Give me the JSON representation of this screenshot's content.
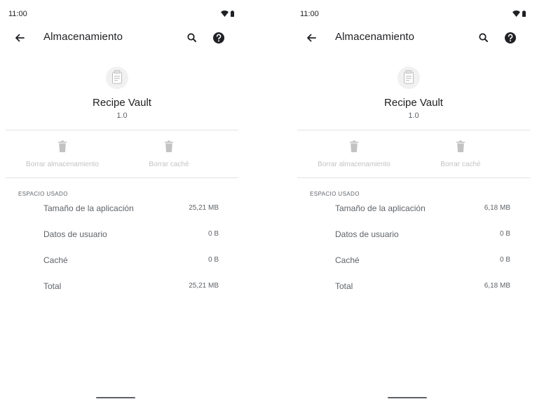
{
  "screens": [
    {
      "status_bar": {
        "time": "11:00"
      },
      "app_bar": {
        "title": "Almacenamiento",
        "icons": [
          "back-arrow-icon",
          "search-icon",
          "help-icon"
        ]
      },
      "app_info": {
        "name": "Recipe Vault",
        "version": "1.0"
      },
      "actions": {
        "clear_storage": "Borrar almacenamiento",
        "clear_cache": "Borrar caché",
        "enabled": false
      },
      "storage": {
        "header": "ESPACIO USADO",
        "rows": [
          {
            "label": "Tamaño de la aplicación",
            "value": "25,21 MB"
          },
          {
            "label": "Datos de usuario",
            "value": "0 B"
          },
          {
            "label": "Caché",
            "value": "0 B"
          },
          {
            "label": "Total",
            "value": "25,21 MB"
          }
        ]
      }
    },
    {
      "status_bar": {
        "time": "11:00"
      },
      "app_bar": {
        "title": "Almacenamiento",
        "icons": [
          "back-arrow-icon",
          "search-icon",
          "help-icon"
        ]
      },
      "app_info": {
        "name": "Recipe Vault",
        "version": "1.0"
      },
      "actions": {
        "clear_storage": "Borrar almacenamiento",
        "clear_cache": "Borrar caché",
        "enabled": false
      },
      "storage": {
        "header": "ESPACIO USADO",
        "rows": [
          {
            "label": "Tamaño de la aplicación",
            "value": "6,18 MB"
          },
          {
            "label": "Datos de usuario",
            "value": "0 B"
          },
          {
            "label": "Caché",
            "value": "0 B"
          },
          {
            "label": "Total",
            "value": "6,18 MB"
          }
        ]
      }
    }
  ],
  "colors": {
    "text_primary": "#202124",
    "text_secondary": "#5f6368",
    "disabled": "#c3c3c3",
    "divider": "#e3e3e3"
  }
}
